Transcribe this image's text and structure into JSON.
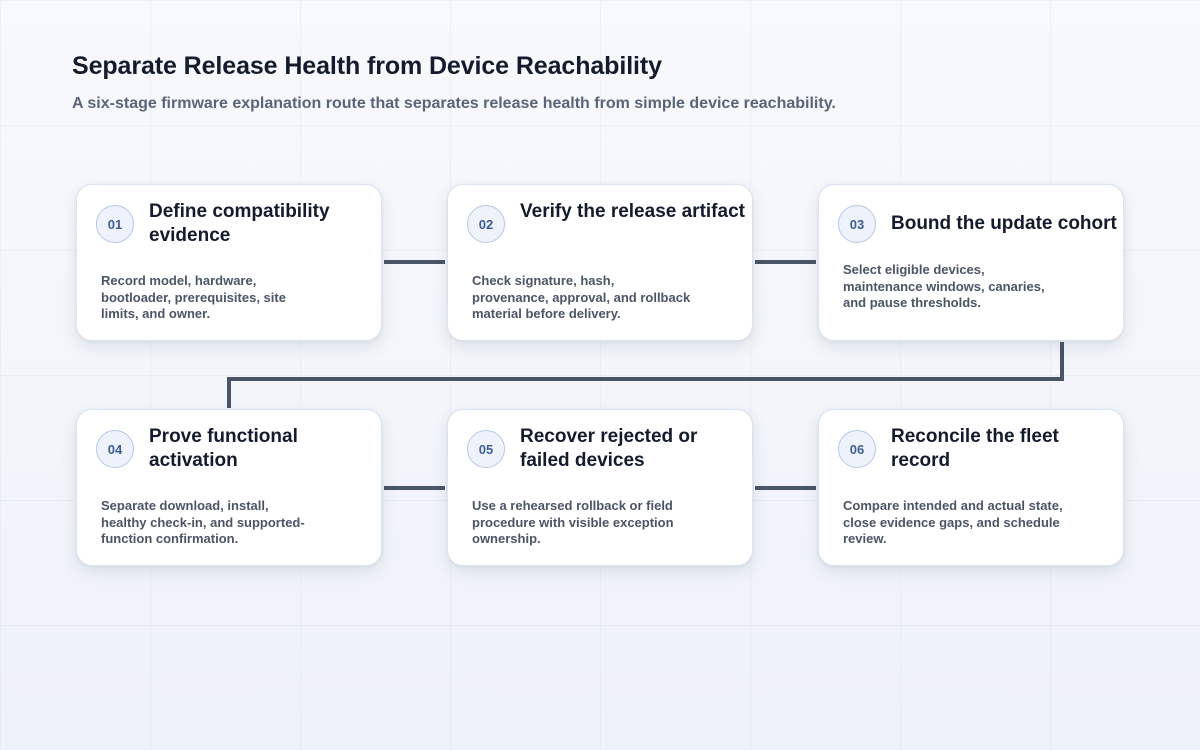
{
  "header": {
    "title": "Separate Release Health from Device Reachability",
    "subtitle": "A six-stage firmware explanation route that separates release health from simple device reachability."
  },
  "stages": [
    {
      "number": "01",
      "title": "Define compatibility evidence",
      "description": "Record model, hardware, bootloader, prerequisites, site limits, and owner."
    },
    {
      "number": "02",
      "title": "Verify the release artifact",
      "description": "Check signature, hash, provenance, approval, and rollback material before delivery."
    },
    {
      "number": "03",
      "title": "Bound the update cohort",
      "description": "Select eligible devices, maintenance windows, canaries, and pause thresholds."
    },
    {
      "number": "04",
      "title": "Prove functional activation",
      "description": "Separate download, install, healthy check-in, and supported-function confirmation."
    },
    {
      "number": "05",
      "title": "Recover rejected or failed devices",
      "description": "Use a rehearsed rollback or field procedure with visible exception ownership."
    },
    {
      "number": "06",
      "title": "Reconcile the fleet record",
      "description": "Compare intended and actual state, close evidence gaps, and schedule review."
    }
  ],
  "colors": {
    "connector": "#4a5568",
    "badge_text": "#3d5e94",
    "badge_border": "#b6c8e6",
    "title_text": "#141b2d",
    "description_text": "#4b5566"
  }
}
